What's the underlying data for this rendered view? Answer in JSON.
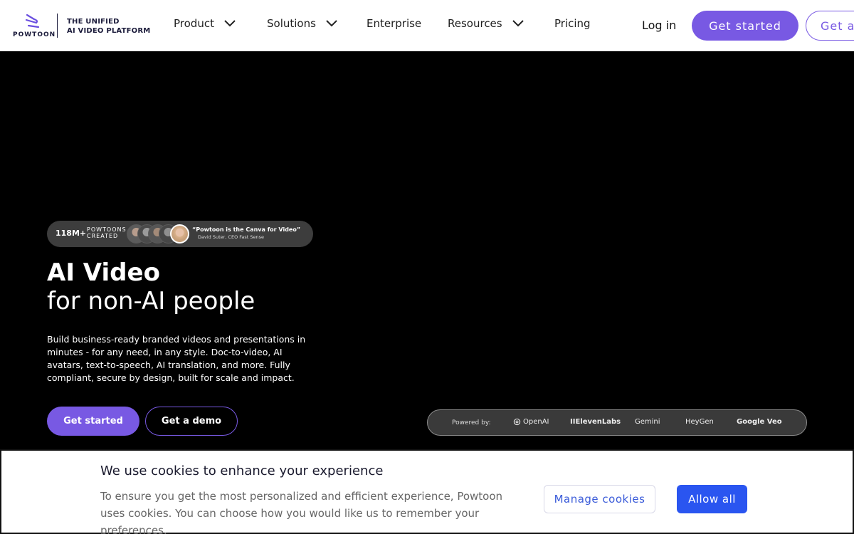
{
  "header": {
    "logo_word": "POWTOON",
    "tagline_line1": "THE UNIFIED",
    "tagline_line2": "AI VIDEO PLATFORM",
    "nav": [
      {
        "label": "Product",
        "has_dropdown": true
      },
      {
        "label": "Solutions",
        "has_dropdown": true
      },
      {
        "label": "Enterprise",
        "has_dropdown": false
      },
      {
        "label": "Resources",
        "has_dropdown": true
      },
      {
        "label": "Pricing",
        "has_dropdown": false
      }
    ],
    "login_label": "Log in",
    "get_started_label": "Get started",
    "get_demo_label": "Get a demo"
  },
  "hero": {
    "stat_count": "118M+",
    "stat_label_line1": "POWTOONS",
    "stat_label_line2": "CREATED",
    "quote": "“Powtoon is the Canva for Video”",
    "quote_author": "David Suter, CEO Fast Sense",
    "title_bold": "AI Video",
    "title_light": "for non-AI people",
    "description": "Build business-ready branded videos and presentations in minutes - for any need, in any style. Doc-to-video, AI avatars, text-to-speech, AI translation, and more. Fully compliant, secure by design, built for scale and impact.",
    "cta_primary": "Get started",
    "cta_secondary": "Get a demo"
  },
  "powered_by": {
    "label": "Powered by:",
    "partners": [
      "OpenAI",
      "IIElevenLabs",
      "Gemini",
      "HeyGen",
      "Google Veo"
    ]
  },
  "cookie_banner": {
    "title": "We use cookies to enhance your experience",
    "text": "To ensure you get the most personalized and efficient experience, Powtoon uses cookies. You can choose how you would like us to remember your preferences.",
    "manage_label": "Manage cookies",
    "allow_label": "Allow all"
  },
  "colors": {
    "brand_purple": "#7859e3",
    "cookie_blue": "#2a55f0",
    "hero_background": "#000000"
  }
}
